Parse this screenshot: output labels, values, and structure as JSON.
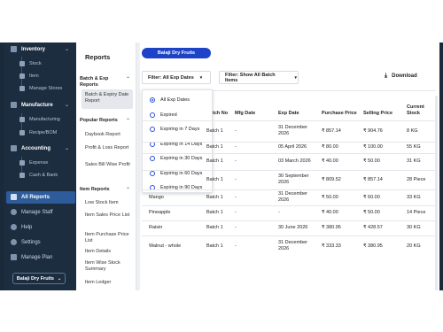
{
  "sidebar": {
    "sections": [
      {
        "label": "Inventory",
        "icon": "inventory-icon",
        "items": [
          "Stock",
          "Item",
          "Manage Stores"
        ]
      },
      {
        "label": "Manufacture",
        "icon": "factory-icon",
        "items": [
          "Manufacturing",
          "Recipe/BOM"
        ]
      },
      {
        "label": "Accounting",
        "icon": "accounting-icon",
        "items": [
          "Expense",
          "Cash & Bank"
        ]
      }
    ],
    "main_items": [
      "All Reports",
      "Manage Staff",
      "Help",
      "Settings",
      "Manage Plan"
    ],
    "store_label": "Balaji Dry Fruits"
  },
  "reports": {
    "title": "Reports",
    "sections": [
      {
        "label": "Batch & Exp Reports",
        "items": [
          "Batch & Expiry Date Report"
        ]
      },
      {
        "label": "Popular Reports",
        "items": [
          "Daybook Report",
          "Profit & Loss Report",
          "Sales Bill Wise Profit"
        ]
      },
      {
        "label": "Item Reports",
        "items": [
          "Low Stock Item",
          "Item Sales Price List",
          "Item Purchase Price List",
          "Item Details",
          "Item Wise Stock Summary",
          "Item Ledger"
        ]
      }
    ]
  },
  "main": {
    "store_pill": "Balaji Dry Fruits",
    "filter_exp": "Filter: All Exp Dates",
    "filter_batch": "Filter: Show All Batch Items",
    "download": "Download",
    "columns": [
      "Batch No",
      "Mfg Date",
      "Exp Date",
      "Purchase Price",
      "Selling Price",
      "Current Stock"
    ],
    "rows": [
      {
        "name": "",
        "batch": "Batch 1",
        "mfg": "-",
        "exp": "31 December 2026",
        "purchase": "₹ 857.14",
        "selling": "₹ 904.76",
        "stock": "8 KG"
      },
      {
        "name": "",
        "batch": "Batch 1",
        "mfg": "-",
        "exp": "05 April 2026",
        "purchase": "₹ 80.00",
        "selling": "₹ 100.00",
        "stock": "55 KG"
      },
      {
        "name": "",
        "batch": "Batch 1",
        "mfg": "-",
        "exp": "03 March 2026",
        "purchase": "₹ 40.00",
        "selling": "₹ 50.00",
        "stock": "31 KG"
      },
      {
        "name": "",
        "batch": "Batch 1",
        "mfg": "-",
        "exp": "30 September 2026",
        "purchase": "₹ 809.52",
        "selling": "₹ 857.14",
        "stock": "28 Piece"
      },
      {
        "name": "Mango",
        "batch": "Batch 1",
        "mfg": "-",
        "exp": "31 December 2026",
        "purchase": "₹ 50.00",
        "selling": "₹ 60.00",
        "stock": "33 KG"
      },
      {
        "name": "Pineapple",
        "batch": "Batch 1",
        "mfg": "-",
        "exp": "-",
        "purchase": "₹ 40.00",
        "selling": "₹ 50.00",
        "stock": "14 Piece"
      },
      {
        "name": "Raisin",
        "batch": "Batch 1",
        "mfg": "-",
        "exp": "30 June 2026",
        "purchase": "₹ 380.95",
        "selling": "₹ 428.57",
        "stock": "30 KG"
      },
      {
        "name": "Walnut - whole",
        "batch": "Batch 1",
        "mfg": "-",
        "exp": "31 December 2026",
        "purchase": "₹ 333.33",
        "selling": "₹ 380.95",
        "stock": "20 KG"
      }
    ]
  },
  "dropdown": {
    "options": [
      "All Exp Dates",
      "Expired",
      "Expiring in 7 Days",
      "Expiring in 14 Days",
      "Expiring in 30 Days",
      "Expiring in 60 Days",
      "Expiring in 90 Days"
    ],
    "selected": "All Exp Dates"
  },
  "colors": {
    "sidebar_bg": "#1c2d40",
    "accent": "#1f43c8",
    "active": "#2e5b9a"
  }
}
